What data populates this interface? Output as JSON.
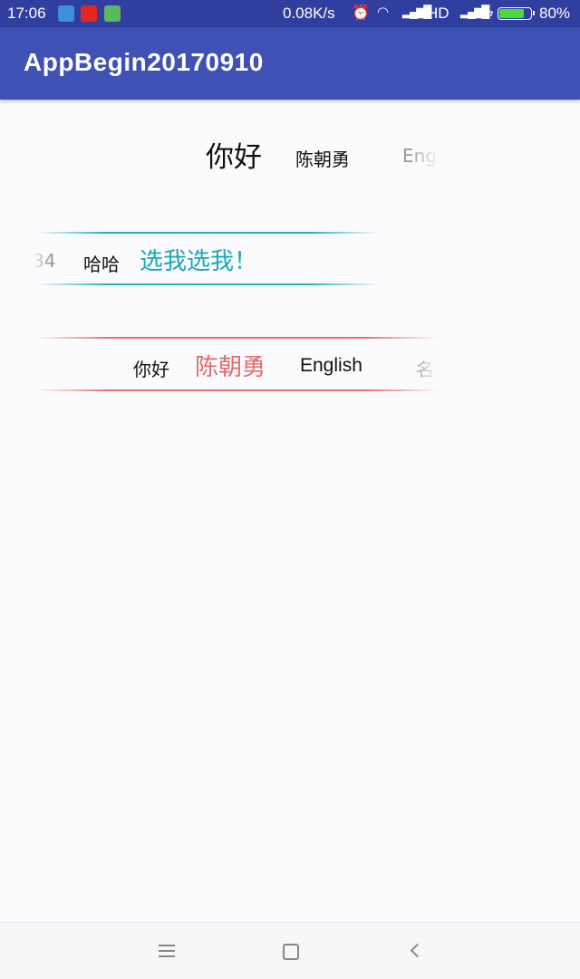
{
  "status_bar": {
    "time": "17:06",
    "net_speed": "0.08K/s",
    "network_type": "HD",
    "battery": "80%",
    "battery_level": 0.8,
    "icons": [
      "usb-icon",
      "netease-music-icon",
      "android-debug-icon",
      "alarm-icon",
      "wifi-icon",
      "signal-icon",
      "charging-icon",
      "battery-icon"
    ]
  },
  "app_bar": {
    "title": "AppBegin20170910"
  },
  "tab_strip_1": {
    "tabs": [
      "你好",
      "陈朝勇",
      "Eng"
    ],
    "selected_index": 0
  },
  "tab_strip_2": {
    "tabs": [
      "34",
      "哈哈",
      "选我选我！"
    ],
    "selected_index": 2,
    "accent_color": "#19a9b5"
  },
  "tab_strip_3": {
    "tabs": [
      "你好",
      "陈朝勇",
      "English",
      "名"
    ],
    "selected_index": 1,
    "accent_color": "#e36a6a"
  },
  "nav_bar": {
    "buttons": [
      "menu-icon",
      "home-icon",
      "back-icon"
    ]
  }
}
